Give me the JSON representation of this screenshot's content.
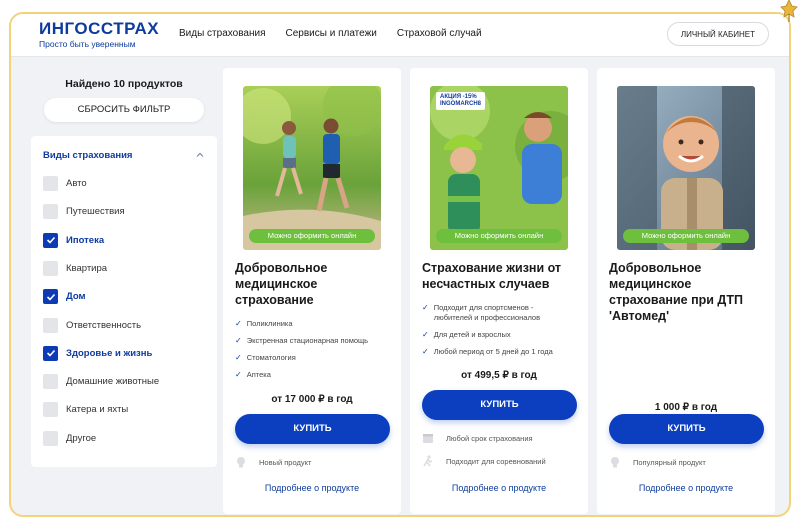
{
  "header": {
    "logo_title": "ИНГОССТРАХ",
    "logo_subtitle": "Просто быть уверенным",
    "nav": [
      "Виды страхования",
      "Сервисы и платежи",
      "Страховой случай"
    ],
    "cabinet_label": "ЛИЧНЫЙ КАБИНЕТ"
  },
  "sidebar": {
    "found_label": "Найдено 10 продуктов",
    "reset_label": "СБРОСИТЬ ФИЛЬТР",
    "section_title": "Виды страхования",
    "options": [
      {
        "label": "Авто",
        "checked": false
      },
      {
        "label": "Путешествия",
        "checked": false
      },
      {
        "label": "Ипотека",
        "checked": true
      },
      {
        "label": "Квартира",
        "checked": false
      },
      {
        "label": "Дом",
        "checked": true
      },
      {
        "label": "Ответственность",
        "checked": false
      },
      {
        "label": "Здоровье и жизнь",
        "checked": true
      },
      {
        "label": "Домашние животные",
        "checked": false
      },
      {
        "label": "Катера и яхты",
        "checked": false
      },
      {
        "label": "Другое",
        "checked": false
      }
    ]
  },
  "cards": [
    {
      "online_badge": "Можно оформить онлайн",
      "title": "Добровольное медицинское страхование",
      "features": [
        "Поликлиника",
        "Экстренная стационарная помощь",
        "Стоматология",
        "Аптека"
      ],
      "price": "от 17 000 ₽ в год",
      "buy_label": "КУПИТЬ",
      "meta": [
        "Новый продукт"
      ],
      "more_label": "Подробнее о продукте"
    },
    {
      "promo_line1": "АКЦИЯ -15%",
      "promo_line2": "INGOMARCH8",
      "online_badge": "Можно оформить онлайн",
      "title": "Страхование жизни от несчастных случаев",
      "features": [
        "Подходит для спортсменов - любителей и профессионалов",
        "Для детей и взрослых",
        "Любой период от 5 дней до 1 года"
      ],
      "price": "от 499,5 ₽ в год",
      "buy_label": "КУПИТЬ",
      "meta": [
        "Любой срок страхования",
        "Подходит для соревнований"
      ],
      "more_label": "Подробнее о продукте"
    },
    {
      "online_badge": "Можно оформить онлайн",
      "title": "Добровольное медицинское страхование при ДТП 'Автомед'",
      "features": [],
      "price": "1 000 ₽ в год",
      "buy_label": "КУПИТЬ",
      "meta": [
        "Популярный продукт"
      ],
      "more_label": "Подробнее о продукте"
    }
  ],
  "colors": {
    "brand": "#0d3b9e",
    "button": "#0b3fc0",
    "online": "#6fbf3e",
    "frame": "#f3d37a"
  }
}
